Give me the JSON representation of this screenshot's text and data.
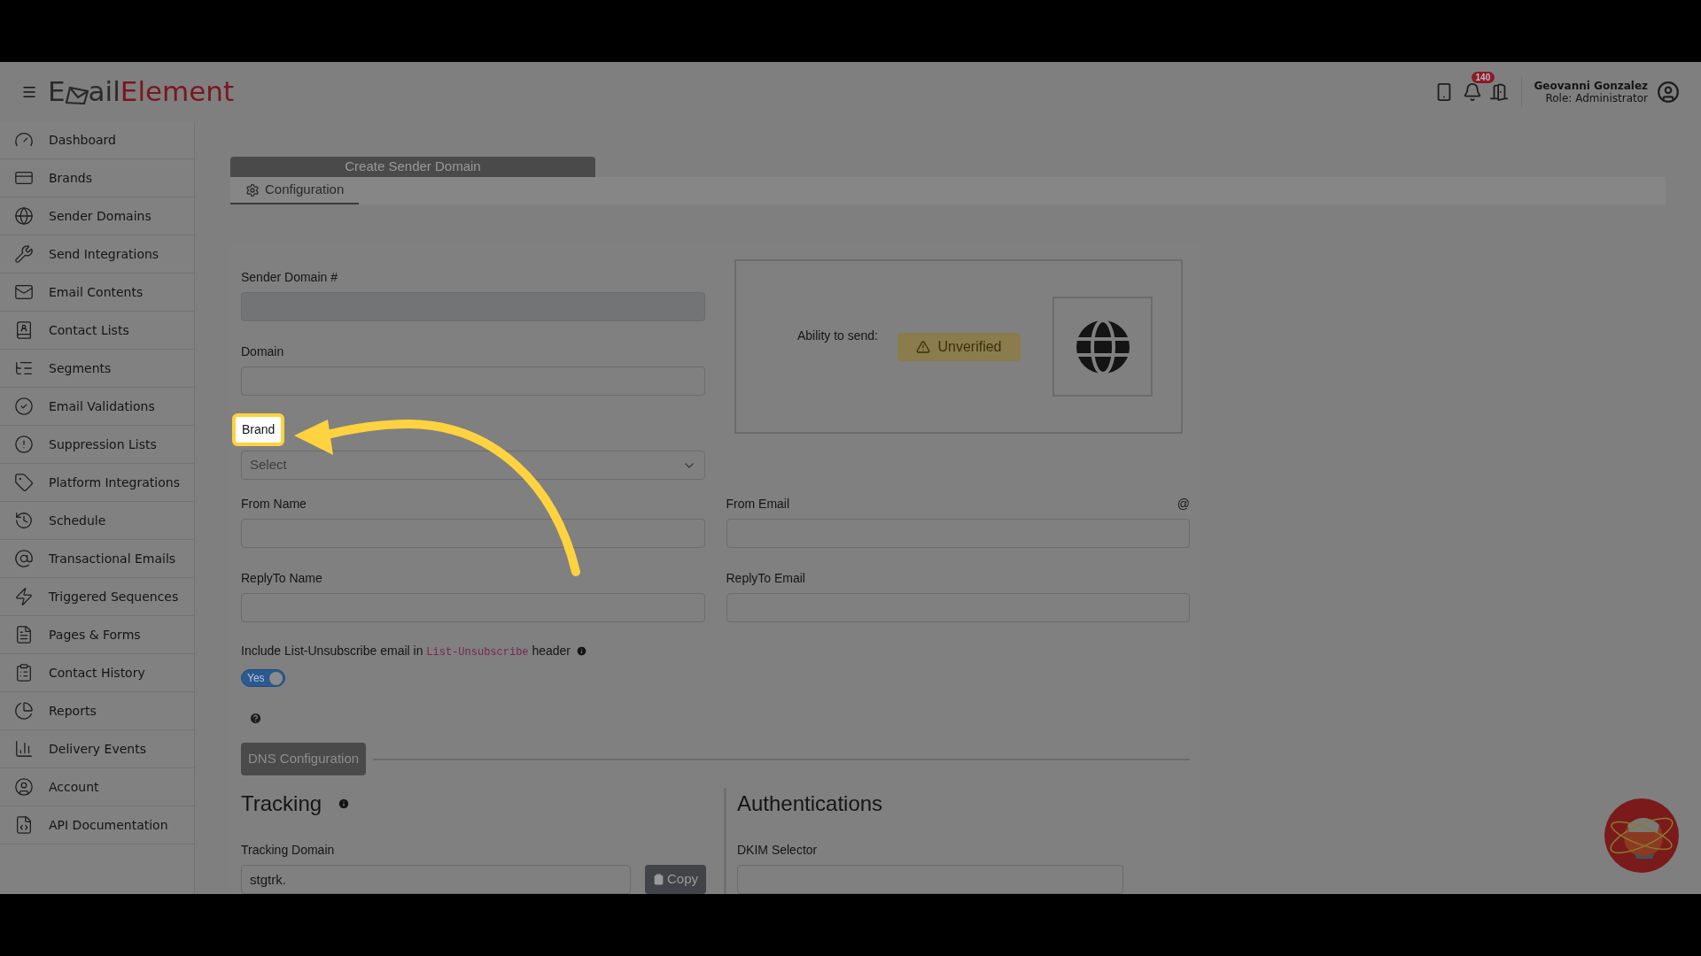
{
  "header": {
    "logo": {
      "dark_start": "E",
      "dark_end": "ail",
      "red": "Element"
    },
    "notification_count": "140",
    "user": {
      "name": "Geovanni Gonzalez",
      "role": "Role: Administrator"
    }
  },
  "sidebar": {
    "items": [
      {
        "label": "Dashboard",
        "kind": "gauge"
      },
      {
        "label": "Brands",
        "kind": "card"
      },
      {
        "label": "Sender Domains",
        "kind": "globe"
      },
      {
        "label": "Send Integrations",
        "kind": "wrench"
      },
      {
        "label": "Email Contents",
        "kind": "mail"
      },
      {
        "label": "Contact Lists",
        "kind": "book"
      },
      {
        "label": "Segments",
        "kind": "list"
      },
      {
        "label": "Email Validations",
        "kind": "check"
      },
      {
        "label": "Suppression Lists",
        "kind": "alert"
      },
      {
        "label": "Platform Integrations",
        "kind": "tag"
      },
      {
        "label": "Schedule",
        "kind": "history"
      },
      {
        "label": "Transactional Emails",
        "kind": "at"
      },
      {
        "label": "Triggered Sequences",
        "kind": "zap"
      },
      {
        "label": "Pages & Forms",
        "kind": "file"
      },
      {
        "label": "Contact History",
        "kind": "clipboard"
      },
      {
        "label": "Reports",
        "kind": "pie"
      },
      {
        "label": "Delivery Events",
        "kind": "bars"
      },
      {
        "label": "Account",
        "kind": "user"
      },
      {
        "label": "API Documentation",
        "kind": "doc"
      }
    ]
  },
  "page_title": "Create Sender Domain",
  "tabs": [
    {
      "label": "Configuration",
      "selected": true
    }
  ],
  "form": {
    "sender_domain_label": "Sender Domain #",
    "domain_label": "Domain",
    "brand": {
      "label": "Brand",
      "placeholder": "Select",
      "highlighted": true
    },
    "from_name_label": "From Name",
    "from_email_label": "From Email",
    "from_email_suffix": "@",
    "reply_to_name_label": "ReplyTo Name",
    "reply_to_email_label": "ReplyTo Email",
    "unsubscribe": {
      "text_before": "Include List-Unsubscribe email in",
      "code": "List-Unsubscribe",
      "text_after": "header",
      "toggle_label": "Yes",
      "on": true
    }
  },
  "status": {
    "label": "Ability to send:",
    "badge": "Unverified"
  },
  "dns_button": "DNS Configuration",
  "tracking": {
    "title": "Tracking",
    "domain_label": "Tracking Domain",
    "domain_value": "stgtrk.",
    "copy_button": "Copy"
  },
  "authentications": {
    "title": "Authentications",
    "dkim_label": "DKIM Selector"
  }
}
